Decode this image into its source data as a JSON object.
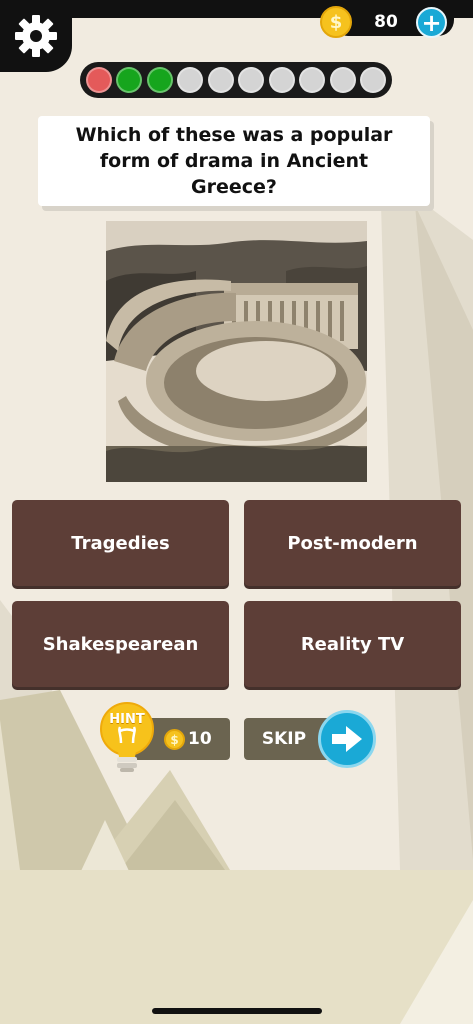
{
  "header": {
    "coin_symbol": "$",
    "coin_count": "80",
    "plus_symbol": "+"
  },
  "progress": {
    "total": 10,
    "dots": [
      "wrong",
      "correct",
      "correct",
      "pending",
      "pending",
      "pending",
      "pending",
      "pending",
      "pending",
      "pending"
    ],
    "colors": {
      "wrong": "#e45a5a",
      "correct": "#16a51d",
      "pending": "#d4d4d4"
    }
  },
  "question": {
    "text": "Which of these was a popular form of drama in Ancient Greece?"
  },
  "picture": {
    "subject": "ancient greek theatre engraving"
  },
  "answers": [
    "Tragedies",
    "Post-modern",
    "Shakespearean",
    "Reality TV"
  ],
  "hint": {
    "label": "HINT",
    "coin_symbol": "$",
    "cost": "10"
  },
  "skip": {
    "label": "SKIP"
  },
  "colors": {
    "answer_bg": "#5d3e37",
    "accent_blue": "#1aa9d6",
    "coin_gold": "#f6c21e",
    "background": "#f1ebe0"
  }
}
